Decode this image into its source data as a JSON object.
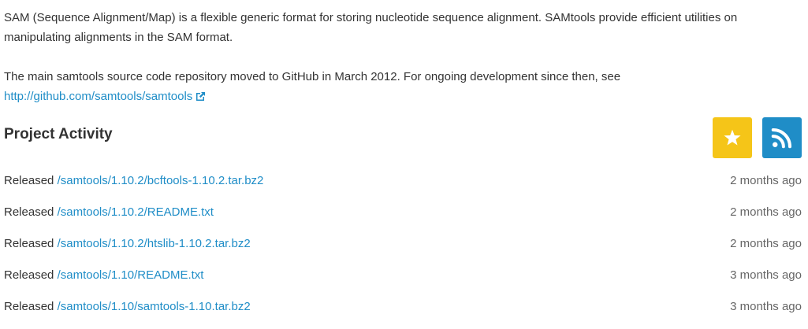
{
  "description": {
    "paragraph1": "SAM (Sequence Alignment/Map) is a flexible generic format for storing nucleotide sequence alignment. SAMtools provide efficient utilities on manipulating alignments in the SAM format.",
    "paragraph2_text": "The main samtools source code repository moved to GitHub in March 2012. For ongoing development since then, see",
    "paragraph2_link": "http://github.com/samtools/samtools"
  },
  "activity": {
    "title": "Project Activity",
    "star_icon": "star-icon",
    "rss_icon": "rss-icon",
    "star_color": "#f5c518",
    "rss_color": "#1f8dc7",
    "items": [
      {
        "prefix": "Released",
        "path": "/samtools/1.10.2/bcftools-1.10.2.tar.bz2",
        "time": "2 months ago"
      },
      {
        "prefix": "Released",
        "path": "/samtools/1.10.2/README.txt",
        "time": "2 months ago"
      },
      {
        "prefix": "Released",
        "path": "/samtools/1.10.2/htslib-1.10.2.tar.bz2",
        "time": "2 months ago"
      },
      {
        "prefix": "Released",
        "path": "/samtools/1.10/README.txt",
        "time": "3 months ago"
      },
      {
        "prefix": "Released",
        "path": "/samtools/1.10/samtools-1.10.tar.bz2",
        "time": "3 months ago"
      }
    ]
  },
  "colors": {
    "link": "#1f8dc7",
    "text": "#333333",
    "muted": "#666666"
  }
}
